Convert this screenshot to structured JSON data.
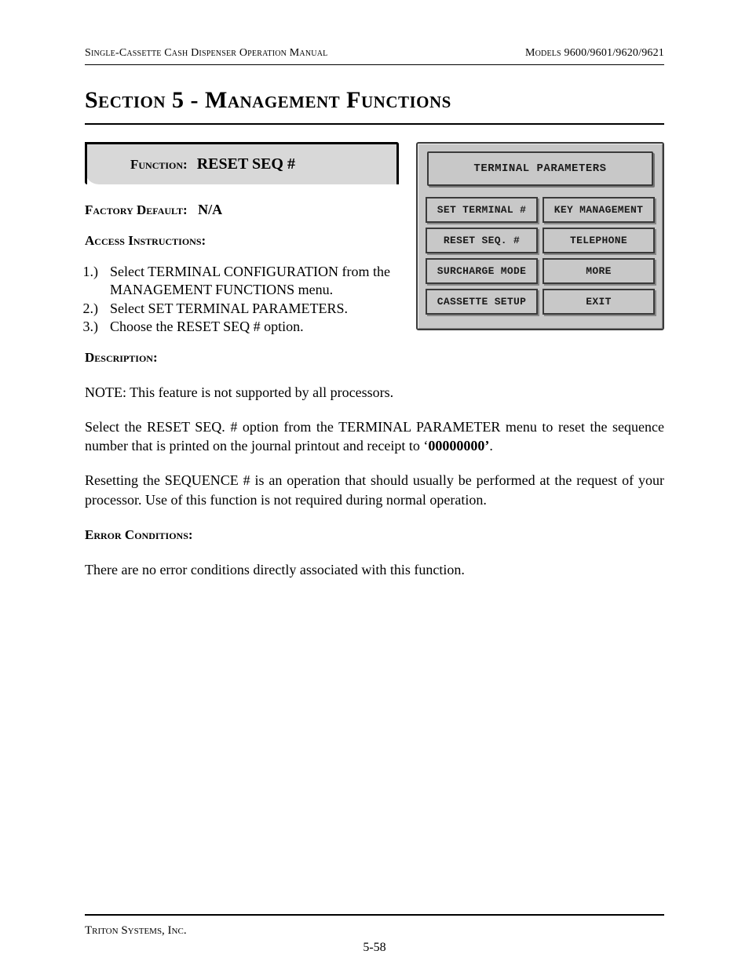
{
  "header": {
    "left": "Single-Cassette Cash Dispenser Operation Manual",
    "right": "Models 9600/9601/9620/9621"
  },
  "section_title": "Section 5 - Management Functions",
  "function_box": {
    "label": "Function:",
    "name": "RESET SEQ #"
  },
  "factory_default": {
    "label": "Factory Default:",
    "value": "N/A"
  },
  "access": {
    "label": "Access Instructions:",
    "steps": [
      "Select TERMINAL CONFIGURATION from the MANAGEMENT FUNCTIONS menu.",
      "Select SET TERMINAL PARAMETERS.",
      "Choose the RESET SEQ # option."
    ]
  },
  "description": {
    "label": "Description:",
    "paragraphs": [
      "NOTE: This feature is not supported by all processors.",
      "Select the RESET SEQ. # option from the TERMINAL PARAMETER menu to reset the sequence number that is printed on the journal printout and receipt to ‘",
      "Resetting the SEQUENCE # is an operation that should usually be performed at the request of your processor. Use of this function is not required during normal operation."
    ],
    "bold_value": "00000000’",
    "after_bold": "."
  },
  "error": {
    "label": "Error Conditions:",
    "text": "There are no error conditions directly associated with this function."
  },
  "terminal": {
    "title": "TERMINAL PARAMETERS",
    "buttons": [
      "SET TERMINAL #",
      "KEY MANAGEMENT",
      "RESET SEQ. #",
      "TELEPHONE",
      "SURCHARGE MODE",
      "MORE",
      "CASSETTE SETUP",
      "EXIT"
    ]
  },
  "footer": {
    "company": "Triton Systems, Inc.",
    "page": "5-58"
  }
}
